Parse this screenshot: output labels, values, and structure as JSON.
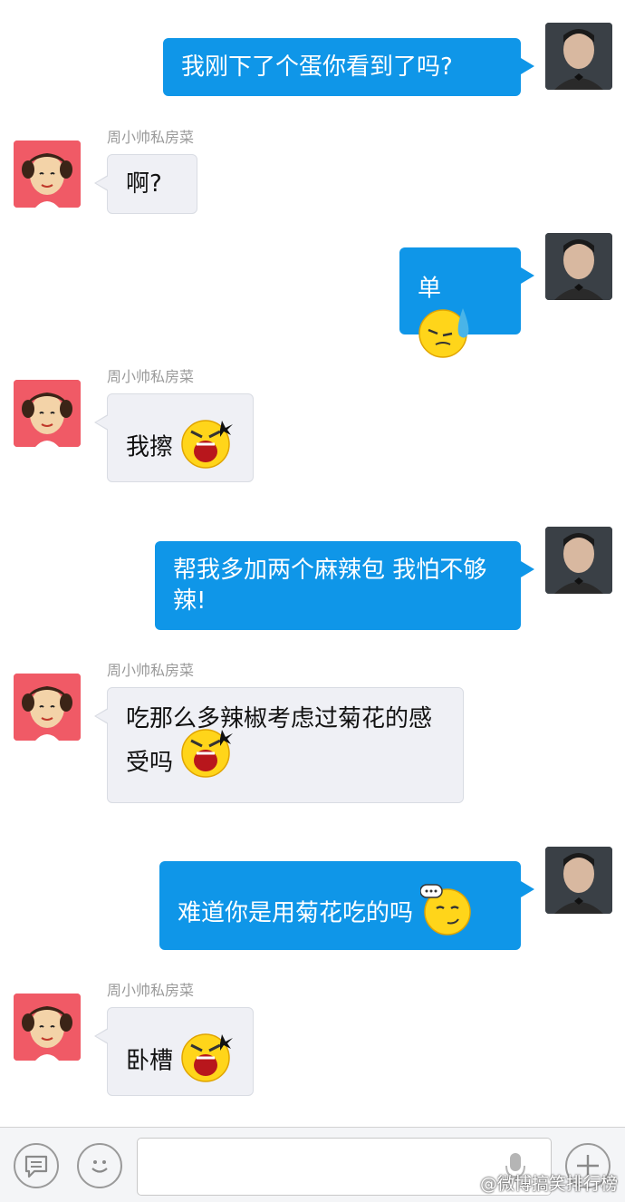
{
  "chat": {
    "messages": [
      {
        "side": "out",
        "text": "我刚下了个蛋你看到了吗?",
        "emoji": ""
      },
      {
        "side": "in",
        "sender": "周小帅私房菜",
        "text": "啊?",
        "emoji": ""
      },
      {
        "side": "out",
        "text": "单",
        "emoji": "sweat-face-emoji"
      },
      {
        "side": "in",
        "sender": "周小帅私房菜",
        "text": "我擦",
        "emoji": "angry-shout-emoji"
      },
      {
        "side": "out",
        "text": "帮我多加两个麻辣包 我怕不够辣!",
        "emoji": ""
      },
      {
        "side": "in",
        "sender": "周小帅私房菜",
        "text": "吃那么多辣椒考虑过菊花的感受吗",
        "emoji": "angry-shout-emoji"
      },
      {
        "side": "out",
        "text": "难道你是用菊花吃的吗",
        "emoji": "speechless-face-emoji"
      },
      {
        "side": "in",
        "sender": "周小帅私房菜",
        "text": "卧槽",
        "emoji": "angry-shout-emoji"
      }
    ]
  },
  "input_bar": {
    "text_value": "",
    "icons": [
      "message-list-icon",
      "smiley-icon",
      "microphone-icon",
      "plus-icon"
    ]
  },
  "watermark": "@微博搞笑排行榜",
  "colors": {
    "outgoing_bubble": "#0f96e8",
    "incoming_bubble": "#eff0f5",
    "sender_name": "#9a9a9a",
    "avatar_other_bg": "#f05a66"
  }
}
